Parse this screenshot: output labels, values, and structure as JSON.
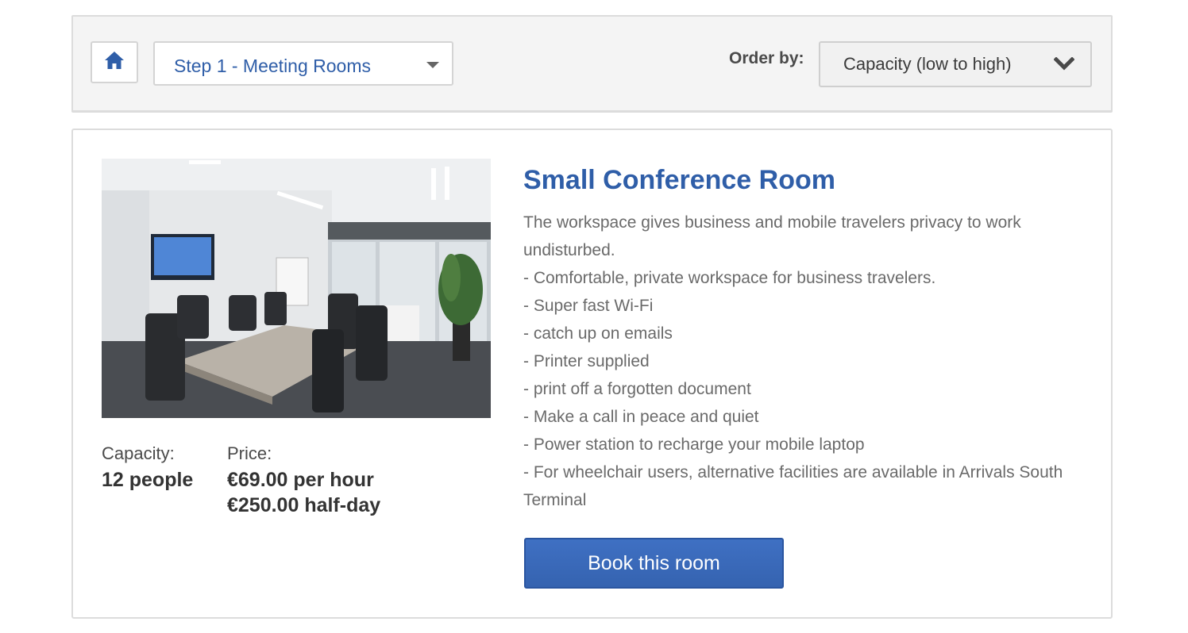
{
  "toolbar": {
    "home_icon": "home-icon",
    "step_select": {
      "selected": "Step 1 - Meeting Rooms",
      "icon": "caret-down-icon"
    },
    "order_label": "Order by:",
    "order_select": {
      "selected": "Capacity (low to high)",
      "icon": "chevron-down-icon"
    }
  },
  "room": {
    "photo_alt": "Small conference room with table, chairs and wall screen",
    "title": "Small Conference Room",
    "description": [
      "The workspace gives business and mobile travelers privacy to work undisturbed.",
      "- Comfortable, private workspace for business travelers.",
      "- Super fast Wi-Fi",
      "- catch up on emails",
      "- Printer supplied",
      "- print off a forgotten document",
      "- Make a call in peace and quiet",
      "- Power station to recharge your mobile laptop",
      "- For wheelchair users, alternative facilities are available in Arrivals South Terminal"
    ],
    "capacity_label": "Capacity:",
    "capacity_value": "12 people",
    "price_label": "Price:",
    "price_hour": "€69.00 per hour",
    "price_half_day": "€250.00 half-day",
    "book_label": "Book this room"
  },
  "colors": {
    "accent": "#2f5ea8",
    "button": "#3866b5",
    "toolbar_bg": "#f4f4f4",
    "border": "#dcdcdc"
  }
}
